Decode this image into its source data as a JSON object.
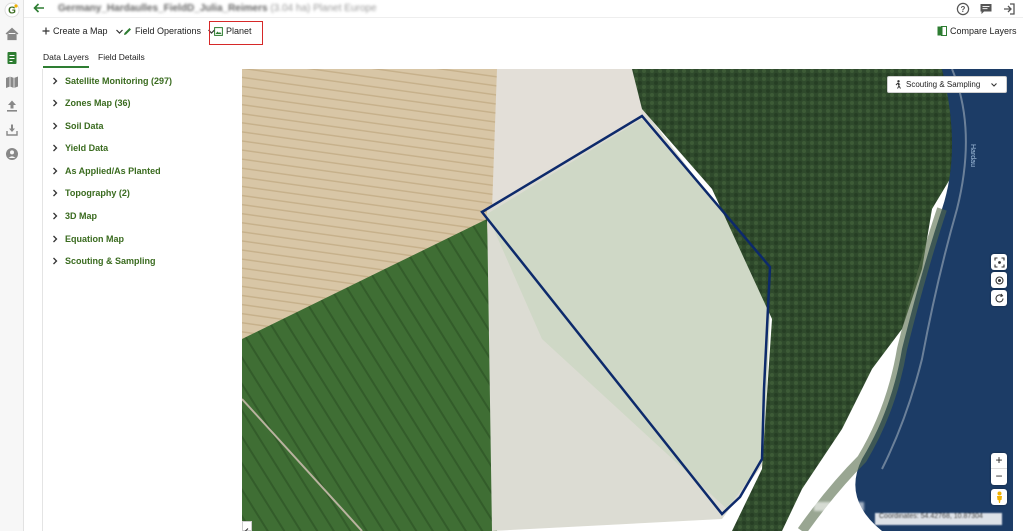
{
  "header": {
    "title_field": "Germany_Hardaulles_FieldD_Julia_Reimers",
    "title_area": "(3.04 ha)",
    "title_suffix": "Planet Europe"
  },
  "toolbar": {
    "create_map": "Create a Map",
    "field_operations": "Field Operations",
    "planet": "Planet",
    "compare_layers": "Compare Layers"
  },
  "tabs": [
    {
      "label": "Data Layers",
      "active": true
    },
    {
      "label": "Field Details",
      "active": false
    }
  ],
  "layers": [
    {
      "label": "Satellite Monitoring (297)"
    },
    {
      "label": "Zones Map (36)"
    },
    {
      "label": "Soil Data"
    },
    {
      "label": "Yield Data"
    },
    {
      "label": "As Applied/As Planted"
    },
    {
      "label": "Topography (2)"
    },
    {
      "label": "3D Map"
    },
    {
      "label": "Equation Map"
    },
    {
      "label": "Scouting & Sampling"
    }
  ],
  "map": {
    "scouting_dropdown": "Scouting & Sampling",
    "zoom_in": "+",
    "zoom_out": "−",
    "coordinates": "Coordinates: 54.42768, 10.87304",
    "street_label": "Hardau"
  },
  "colors": {
    "accent_green": "#3a6b1f",
    "highlight_red": "#d62828",
    "field_boundary": "#0d2a6b"
  },
  "icons": [
    "home-icon",
    "notes-icon",
    "map-icon",
    "upload-icon",
    "download-icon",
    "account-icon",
    "help-icon",
    "chat-icon",
    "logout-icon",
    "back-icon"
  ]
}
